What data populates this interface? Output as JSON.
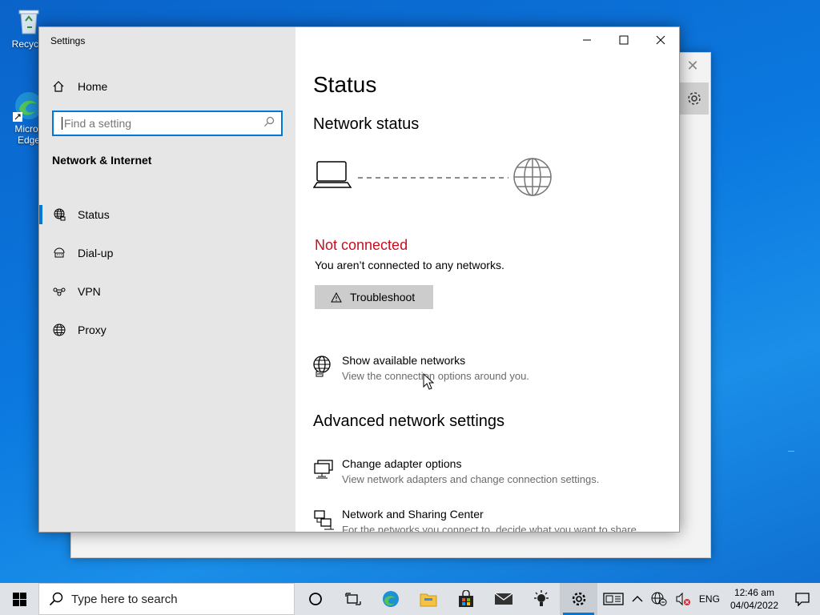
{
  "desktop": {
    "icons": [
      {
        "label": "Recycle",
        "icon": "recycle-bin-icon"
      },
      {
        "label": "Micros Edge",
        "icon": "edge-icon"
      }
    ]
  },
  "settings_window": {
    "title": "Settings",
    "controls": {
      "minimize": "minimize-icon",
      "maximize": "maximize-icon",
      "close": "close-icon"
    }
  },
  "sidebar": {
    "home_label": "Home",
    "search_placeholder": "Find a setting",
    "section_title": "Network & Internet",
    "items": [
      {
        "label": "Status",
        "icon": "globe-status-icon",
        "active": true
      },
      {
        "label": "Dial-up",
        "icon": "dialup-icon",
        "active": false
      },
      {
        "label": "VPN",
        "icon": "vpn-icon",
        "active": false
      },
      {
        "label": "Proxy",
        "icon": "globe-icon",
        "active": false
      }
    ]
  },
  "main": {
    "title": "Status",
    "network_status_heading": "Network status",
    "connection_state": "Not connected",
    "connection_desc": "You aren’t connected to any networks.",
    "troubleshoot_label": "Troubleshoot",
    "available": {
      "title": "Show available networks",
      "desc": "View the connection options around you."
    },
    "advanced_heading": "Advanced network settings",
    "adapter": {
      "title": "Change adapter options",
      "desc": "View network adapters and change connection settings."
    },
    "sharing": {
      "title": "Network and Sharing Center",
      "desc": "For the networks you connect to, decide what you want to share."
    }
  },
  "taskbar": {
    "search_placeholder": "Type here to search",
    "apps": [
      "cortana-icon",
      "task-view-icon",
      "edge-icon",
      "file-explorer-icon",
      "store-icon",
      "mail-icon",
      "tips-icon",
      "settings-gear-icon"
    ],
    "tray": {
      "language": "ENG",
      "time": "12:46 am",
      "date": "04/04/2022"
    }
  },
  "colors": {
    "accent": "#0078d7",
    "error": "#c50f1f",
    "sidebar_bg": "#e6e6e6",
    "desktop_bg": "#0b79e0"
  }
}
